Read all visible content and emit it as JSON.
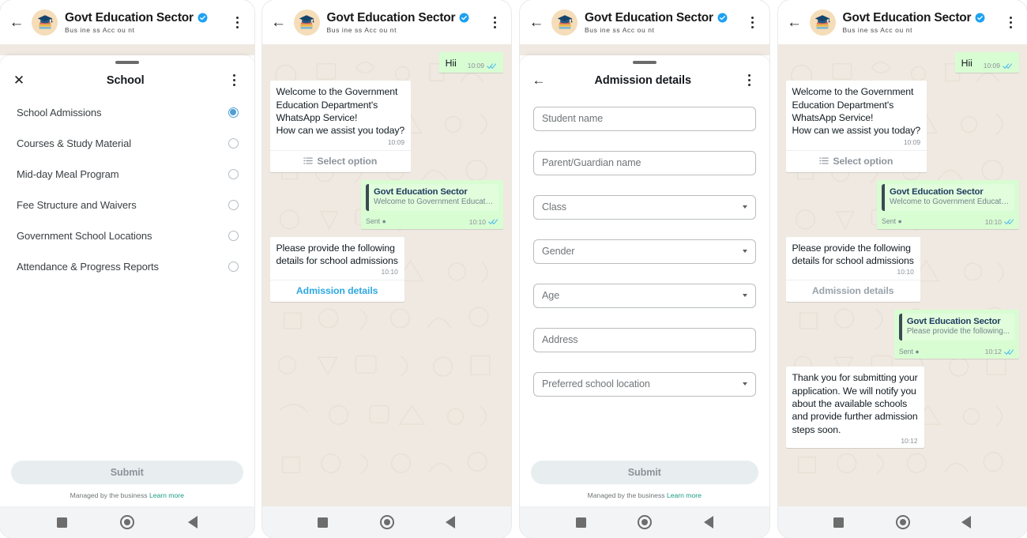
{
  "header": {
    "back_icon": "back-arrow-icon",
    "avatar_icon": "graduation-cap-books-avatar",
    "business_name": "Govt Education Sector",
    "verified_icon": "verified-badge-icon",
    "subtitle": "Bus ine ss Acc ou nt",
    "menu_icon": "kebab-menu-icon",
    "accent_verified": "#1da1f2"
  },
  "nav": {
    "recents_icon": "square-recents-icon",
    "home_icon": "circle-home-icon",
    "back_icon": "triangle-back-icon"
  },
  "panel1": {
    "sheet": {
      "close_icon": "close-x-icon",
      "title": "School",
      "menu_icon": "kebab-menu-icon"
    },
    "options": [
      {
        "label": "School Admissions",
        "selected": true
      },
      {
        "label": "Courses & Study Material",
        "selected": false
      },
      {
        "label": "Mid-day Meal Program",
        "selected": false
      },
      {
        "label": "Fee Structure and Waivers",
        "selected": false
      },
      {
        "label": "Government School Locations",
        "selected": false
      },
      {
        "label": "Attendance & Progress Reports",
        "selected": false
      }
    ],
    "submit_label": "Submit",
    "managed_text": "Managed by the business ",
    "learn_more": "Learn more"
  },
  "panel2": {
    "messages": [
      {
        "kind": "out",
        "text": "Hii",
        "time": "10:09",
        "ticks": "double-check-blue"
      },
      {
        "kind": "in",
        "text": "Welcome to the Government\nEducation Department's\nWhatsApp Service!\nHow can we assist you today?",
        "time": "10:09",
        "cta": "Select option",
        "cta_state": "list-disabled",
        "cta_icon": "list-lines-icon"
      },
      {
        "kind": "out-quoted",
        "quote_title": "Govt Education Sector",
        "quote_sub": "Welcome to Government Education...",
        "sent_label": "Sent",
        "time": "10:10",
        "ticks": "double-check-blue"
      },
      {
        "kind": "in",
        "text": "Please provide the following\ndetails for school admissions",
        "time": "10:10",
        "cta": "Admission details",
        "cta_state": "link"
      }
    ]
  },
  "panel3": {
    "sheet": {
      "back_icon": "back-arrow-icon",
      "title": "Admission details",
      "menu_icon": "kebab-menu-icon"
    },
    "fields": [
      {
        "placeholder": "Student name",
        "type": "text"
      },
      {
        "placeholder": "Parent/Guardian name",
        "type": "text"
      },
      {
        "placeholder": "Class",
        "type": "select"
      },
      {
        "placeholder": "Gender",
        "type": "select"
      },
      {
        "placeholder": "Age",
        "type": "select"
      },
      {
        "placeholder": "Address",
        "type": "text"
      },
      {
        "placeholder": "Preferred school location",
        "type": "select"
      }
    ],
    "submit_label": "Submit",
    "managed_text": "Managed by the business ",
    "learn_more": "Learn more"
  },
  "panel4": {
    "messages": [
      {
        "kind": "out",
        "text": "Hii",
        "time": "10:09",
        "ticks": "double-check-blue"
      },
      {
        "kind": "in",
        "text": "Welcome to the Government\nEducation Department's\nWhatsApp Service!\nHow can we assist you today?",
        "time": "10:09",
        "cta": "Select option",
        "cta_state": "list-disabled",
        "cta_icon": "list-lines-icon"
      },
      {
        "kind": "out-quoted",
        "quote_title": "Govt Education Sector",
        "quote_sub": "Welcome to Government Education...",
        "sent_label": "Sent",
        "time": "10:10",
        "ticks": "double-check-blue"
      },
      {
        "kind": "in",
        "text": "Please provide the following\ndetails for school admissions",
        "time": "10:10",
        "cta": "Admission details",
        "cta_state": "disabled"
      },
      {
        "kind": "out-quoted",
        "quote_title": "Govt Education Sector",
        "quote_sub": "Please provide the following...",
        "sent_label": "Sent",
        "time": "10:12",
        "ticks": "double-check-blue"
      },
      {
        "kind": "in",
        "text": "Thank you for submitting your\napplication. We will notify you\nabout the available schools\nand provide further admission\nsteps soon.",
        "time": "10:12"
      }
    ]
  },
  "colors": {
    "chat_bg": "#efe9e1",
    "out_bubble": "#d9fdd3",
    "in_bubble": "#ffffff",
    "link": "#2fa8e0",
    "learn_more": "#1a9c82"
  }
}
